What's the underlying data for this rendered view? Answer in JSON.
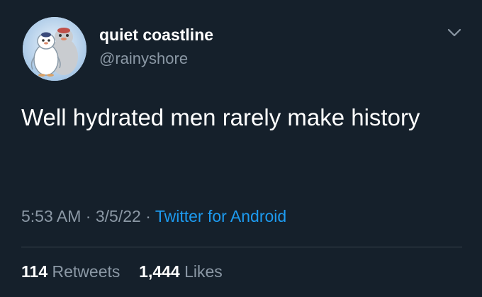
{
  "tweet": {
    "display_name": "quiet coastline",
    "handle": "@rainyshore",
    "text": "Well hydrated men rarely make history",
    "time": "5:53 AM",
    "date": "3/5/22",
    "separator": "·",
    "source": "Twitter for Android",
    "retweets": {
      "count": "114",
      "label": "Retweets"
    },
    "likes": {
      "count": "1,444",
      "label": "Likes"
    },
    "avatar_icon": "penguins-avatar",
    "menu_icon": "chevron-down-icon"
  },
  "colors": {
    "background": "#15202b",
    "text_primary": "#ffffff",
    "text_secondary": "#8b98a5",
    "link": "#1d9bf0",
    "divider": "#38444d"
  }
}
